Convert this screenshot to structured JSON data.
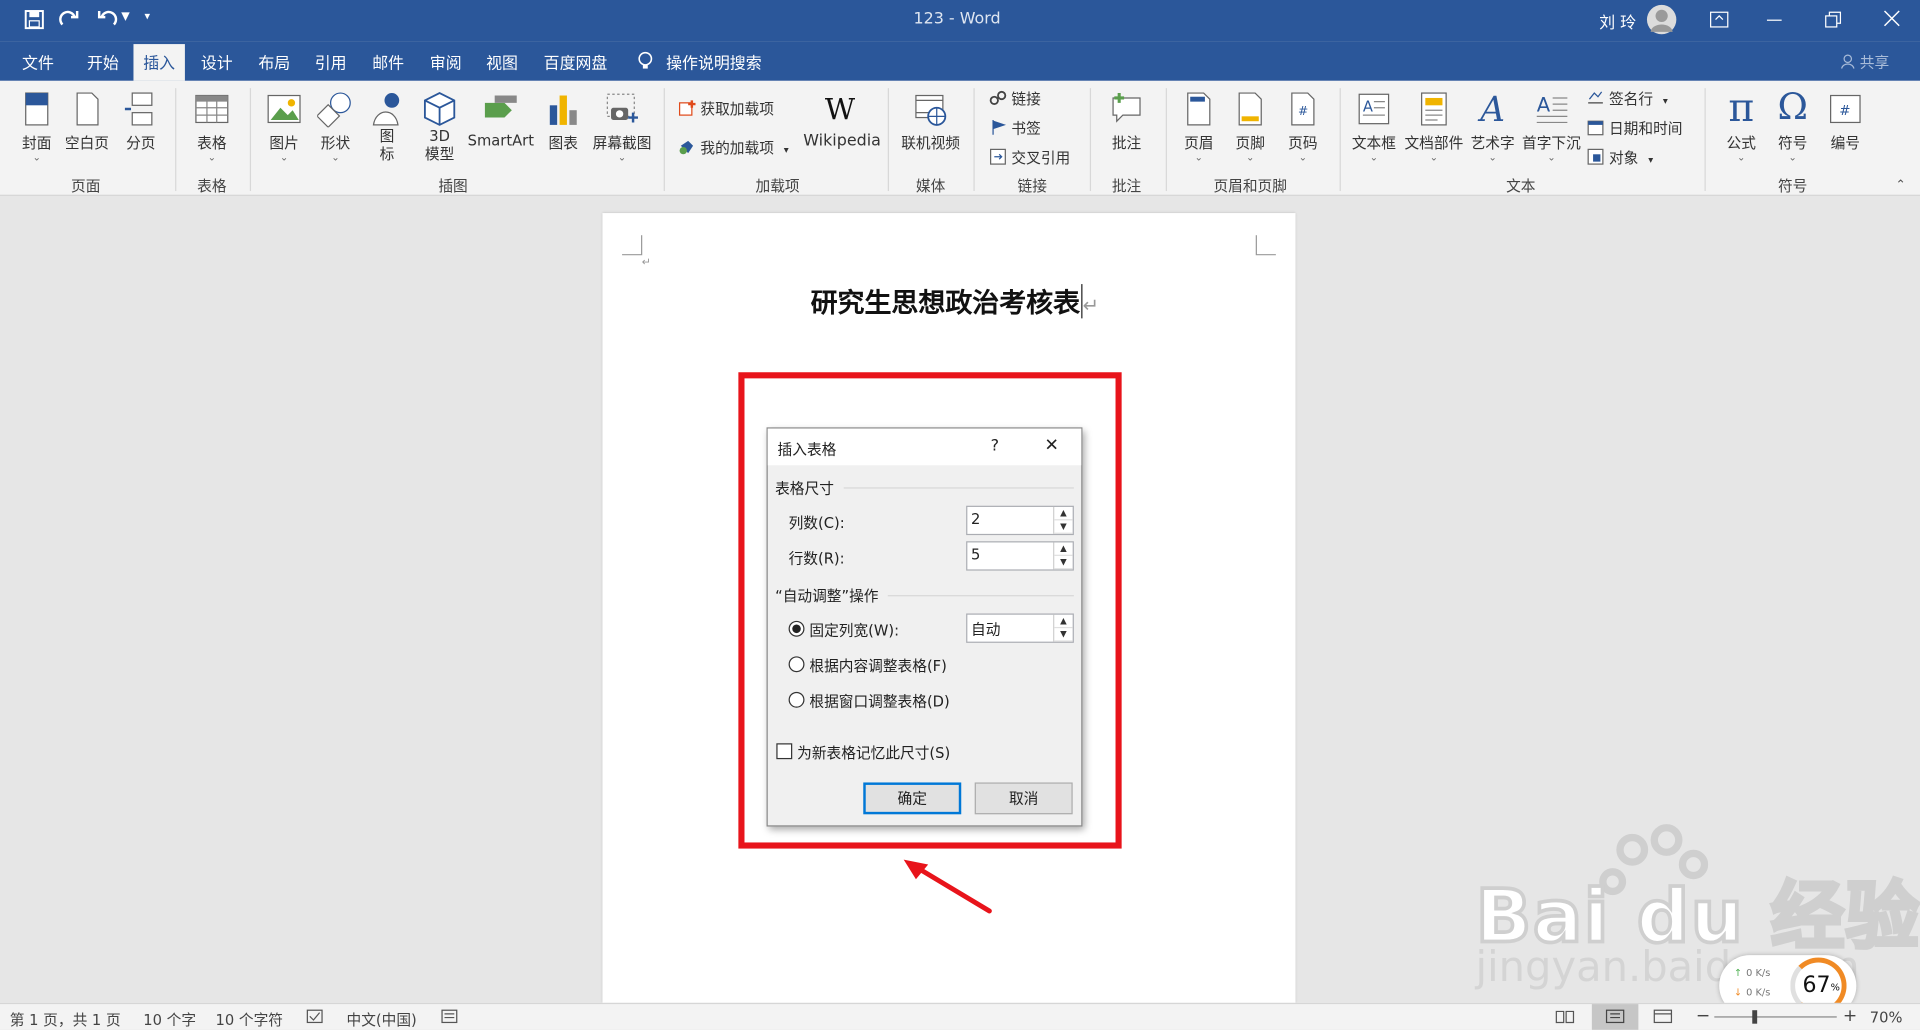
{
  "window": {
    "title": "123  -  Word",
    "user": "刘 玲"
  },
  "qat": {
    "save": "save-icon",
    "redo": "redo-icon",
    "undo": "undo-icon",
    "more": "▾"
  },
  "tabs": [
    {
      "label": "文件"
    },
    {
      "label": "开始"
    },
    {
      "label": "插入"
    },
    {
      "label": "设计"
    },
    {
      "label": "布局"
    },
    {
      "label": "引用"
    },
    {
      "label": "邮件"
    },
    {
      "label": "审阅"
    },
    {
      "label": "视图"
    },
    {
      "label": "百度网盘"
    }
  ],
  "tell_me": "操作说明搜索",
  "share": "共享",
  "ribbon": {
    "pages": {
      "cover": "封面",
      "blank": "空白页",
      "break": "分页",
      "group": "页面"
    },
    "tables": {
      "table": "表格",
      "group": "表格"
    },
    "illustrations": {
      "picture": "图片",
      "shapes": "形状",
      "icons_1": "图",
      "icons_2": "标",
      "model_1": "3D",
      "model_2": "模型",
      "smartart": "SmartArt",
      "chart": "图表",
      "screenshot": "屏幕截图",
      "group": "插图"
    },
    "addins": {
      "get": "获取加载项",
      "mine": "我的加载项",
      "wiki_glyph": "W",
      "wikipedia": "Wikipedia",
      "group": "加载项"
    },
    "media": {
      "video": "联机视频",
      "group": "媒体"
    },
    "links": {
      "link": "链接",
      "bookmark": "书签",
      "crossref": "交叉引用",
      "group": "链接"
    },
    "comments": {
      "comment": "批注",
      "group": "批注"
    },
    "headerfooter": {
      "header": "页眉",
      "footer": "页脚",
      "pagenum": "页码",
      "group": "页眉和页脚"
    },
    "text": {
      "textbox": "文本框",
      "parts": "文档部件",
      "wordart": "艺术字",
      "dropcap": "首字下沉",
      "signature": "签名行",
      "datetime": "日期和时间",
      "object": "对象",
      "group": "文本"
    },
    "symbols": {
      "equation": "公式",
      "symbol": "符号",
      "number": "编号",
      "group": "符号",
      "pi": "π",
      "omega": "Ω",
      "hash": "#"
    }
  },
  "document": {
    "title": "研究生思想政治考核表",
    "para_mark": "↵"
  },
  "dialog": {
    "title": "插入表格",
    "help": "?",
    "close": "✕",
    "section_size": "表格尺寸",
    "cols_label": "列数(C):",
    "cols_value": "2",
    "rows_label": "行数(R):",
    "rows_value": "5",
    "section_autofit": "“自动调整”操作",
    "fixed_label": "固定列宽(W):",
    "fixed_value": "自动",
    "content_label": "根据内容调整表格(F)",
    "window_label": "根据窗口调整表格(D)",
    "remember_label": "为新表格记忆此尺寸(S)",
    "ok": "确定",
    "cancel": "取消"
  },
  "statusbar": {
    "page": "第 1 页，共 1 页",
    "words": "10 个字",
    "chars": "10 个字符",
    "lang": "中文(中国)",
    "zoom": "70%",
    "zoom_percent": 70
  },
  "watermark": {
    "logo_text": "Bai du 经验",
    "url": "jingyan.baidu.com"
  },
  "overlay": {
    "speed_up": "0 K/s",
    "speed_down": "0 K/s",
    "cpu": "67",
    "cpu_unit": "%"
  },
  "colors": {
    "brand": "#2b579a",
    "highlight": "#e8141b",
    "default_button": "#0078d7"
  }
}
